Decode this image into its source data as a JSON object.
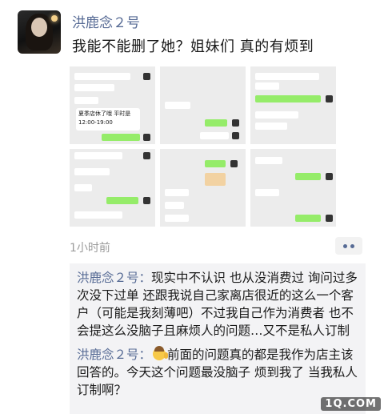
{
  "post": {
    "author": "洪鹿念２号",
    "text": "我能不能删了她？姐妹们 真的有烦到",
    "time": "1小时前",
    "image_count": 9
  },
  "comments": [
    {
      "name": "洪鹿念２号",
      "sep": "：",
      "text": "现实中不认识 也从没消费过 询问过多次没下过单 还跟我说自己家离店很近的这么一个客户（可能是我刻薄吧）不过我自己作为消费者 也不会提这么没脑子且麻烦人的问题…又不是私人订制"
    },
    {
      "name": "洪鹿念２号",
      "sep": "：",
      "text": "前面的问题真的都是我作为店主该回答的。今天这个问题最没脑子 烦到我了 当我私人订制啊？"
    }
  ],
  "thumbs": {
    "t1_line1": "夏季店休了哦 平时是",
    "t1_line2": "12:00-19:00"
  },
  "watermark": "1Q.COM",
  "colors": {
    "name": "#576b95",
    "comment_bg": "#f3f3f5",
    "wechat_green": "#95ec69"
  }
}
